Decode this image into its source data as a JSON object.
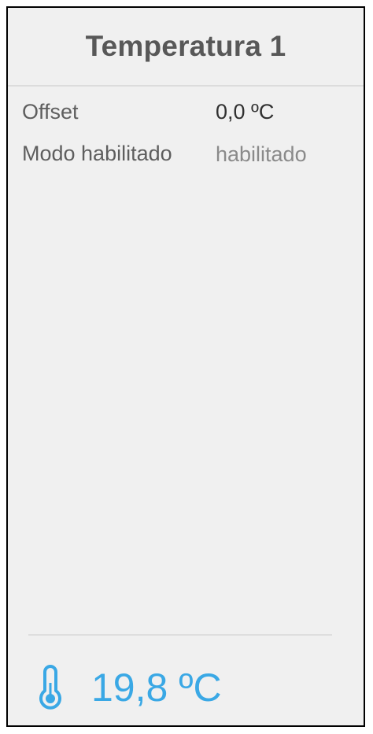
{
  "header": {
    "title": "Temperatura 1"
  },
  "settings": {
    "offset_label": "Offset",
    "offset_value": "0,0 ºC",
    "mode_label": "Modo habilitado",
    "mode_value": "habilitado"
  },
  "reading": {
    "icon": "thermometer-icon",
    "value": "19,8 ºC"
  },
  "colors": {
    "accent": "#3aa8e5",
    "title": "#585858",
    "background": "#f0f0f0"
  }
}
